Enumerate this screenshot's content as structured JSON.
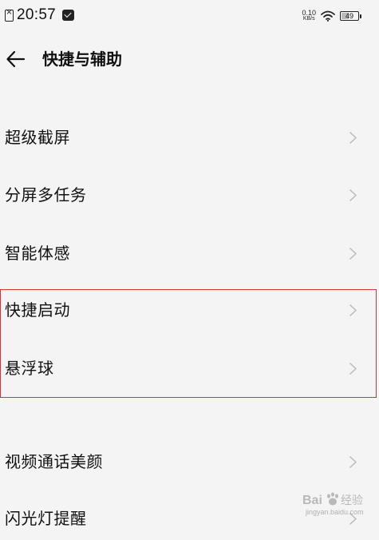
{
  "status_bar": {
    "time": "20:57",
    "net_speed_value": "0.10",
    "net_speed_unit": "KB/s",
    "battery_level": "49",
    "battery_fraction": 0.49
  },
  "header": {
    "title": "快捷与辅助"
  },
  "menu": {
    "items": [
      {
        "label": "超级截屏"
      },
      {
        "label": "分屏多任务"
      },
      {
        "label": "智能体感"
      },
      {
        "label": "快捷启动"
      },
      {
        "label": "悬浮球"
      },
      {
        "label": "视频通话美颜"
      },
      {
        "label": "闪光灯提醒"
      }
    ]
  },
  "highlight": {
    "color": "#c8393b"
  },
  "watermark": {
    "text": "Baidu 经验",
    "url_text": "jingyan.baidu.com"
  },
  "icons": {
    "sim": "sim-card-icon",
    "message": "message-notification-icon",
    "wifi": "wifi-icon",
    "battery": "battery-icon",
    "back": "back-arrow-icon",
    "chevron": "chevron-right-icon"
  }
}
